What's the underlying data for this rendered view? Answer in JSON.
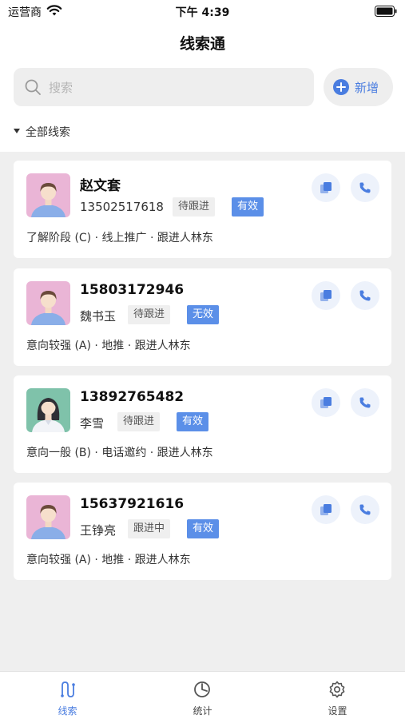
{
  "status_bar": {
    "carrier": "运营商",
    "time": "下午 4:39"
  },
  "header": {
    "title": "线索通"
  },
  "search": {
    "placeholder": "搜索",
    "icon": "search-icon"
  },
  "add_button": {
    "label": "新增",
    "icon": "plus-circle-icon"
  },
  "filter": {
    "label": "全部线索"
  },
  "colors": {
    "accent": "#4a7de0",
    "valid_tag": "#5b8fe8",
    "page_background": "#efefef"
  },
  "leads": [
    {
      "line1": "赵文套",
      "line2": "13502517618",
      "status": "待跟进",
      "validity": "有效",
      "description": "了解阶段 (C) · 线上推广 · 跟进人林东",
      "avatar": "male-avatar"
    },
    {
      "line1": "15803172946",
      "line2": "魏书玉",
      "status": "待跟进",
      "validity": "无效",
      "description": "意向较强 (A) · 地推 · 跟进人林东",
      "avatar": "male-avatar"
    },
    {
      "line1": "13892765482",
      "line2": "李雪",
      "status": "待跟进",
      "validity": "有效",
      "description": "意向一般 (B) · 电话邀约 · 跟进人林东",
      "avatar": "female-avatar"
    },
    {
      "line1": "15637921616",
      "line2": "王铮亮",
      "status": "跟进中",
      "validity": "有效",
      "description": "意向较强 (A) · 地推 · 跟进人林东",
      "avatar": "male-avatar"
    }
  ],
  "tabbar": {
    "items": [
      {
        "label": "线索",
        "icon": "route-icon",
        "active": true
      },
      {
        "label": "统计",
        "icon": "pie-chart-icon",
        "active": false
      },
      {
        "label": "设置",
        "icon": "gear-icon",
        "active": false
      }
    ]
  }
}
